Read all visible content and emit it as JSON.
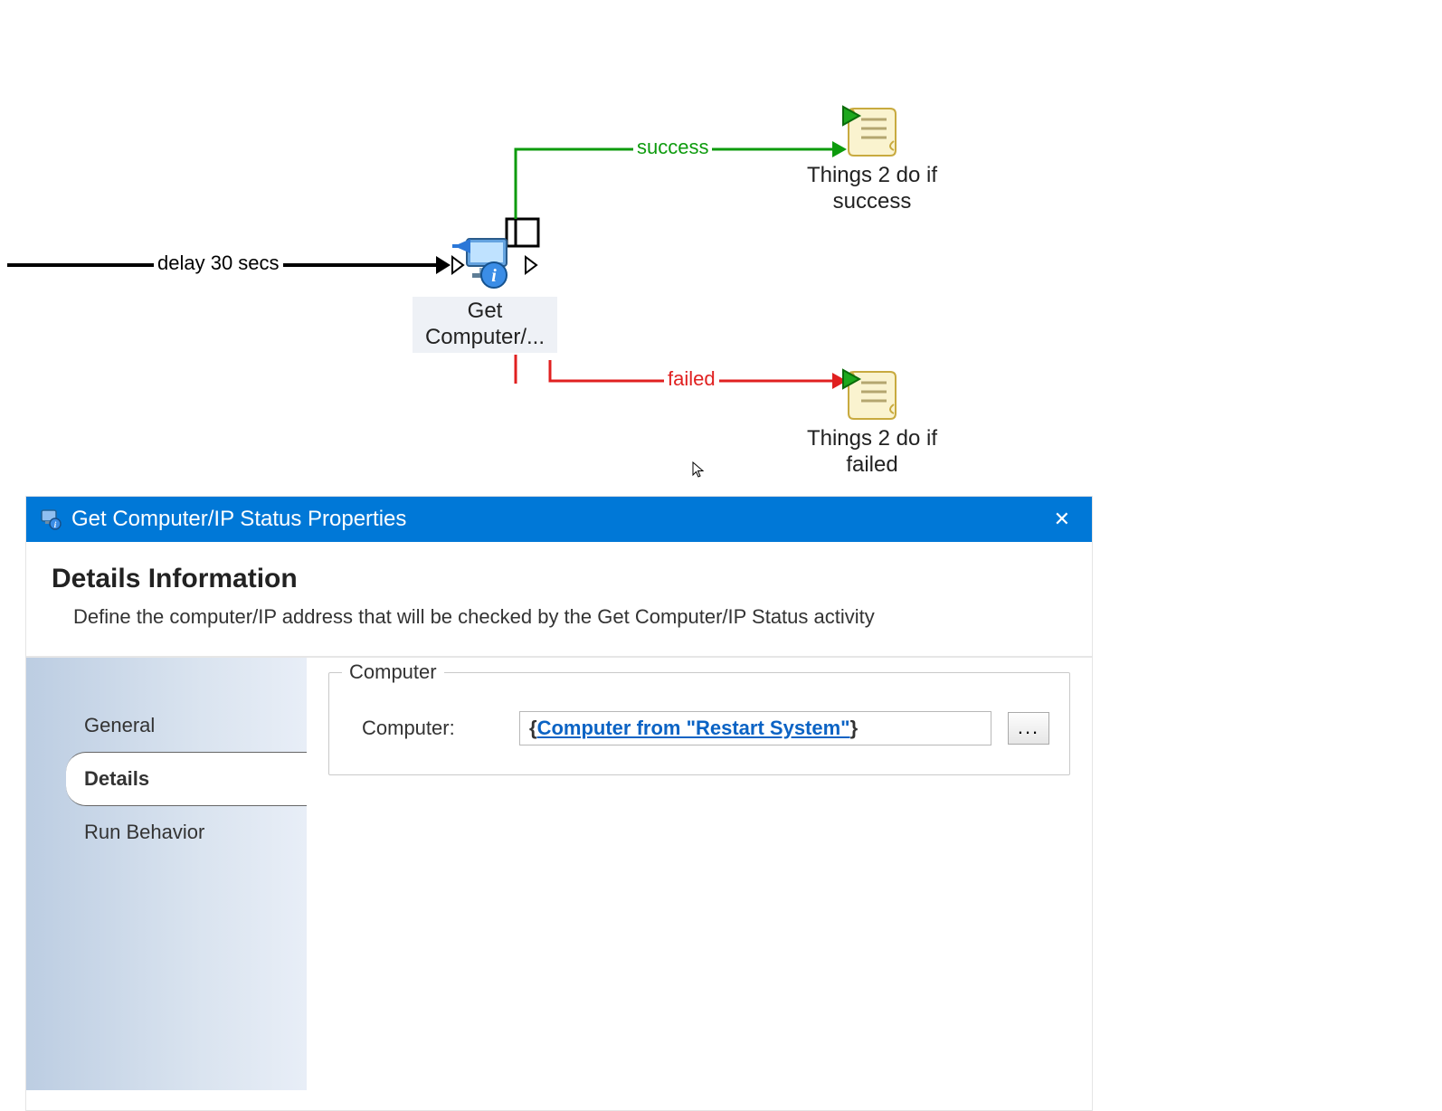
{
  "diagram": {
    "edges": {
      "delay": {
        "label": "delay 30 secs",
        "color": "#000000"
      },
      "success": {
        "label": "success",
        "color": "#0d9b0d"
      },
      "failed": {
        "label": "failed",
        "color": "#e02020"
      }
    },
    "nodes": {
      "get_computer": {
        "label": "Get Computer/...",
        "icon": "computer-info-icon"
      },
      "success_script": {
        "label": "Things 2 do if success",
        "icon": "script-play-icon"
      },
      "failed_script": {
        "label": "Things 2 do if failed",
        "icon": "script-play-icon"
      }
    }
  },
  "dialog": {
    "title": "Get Computer/IP Status Properties",
    "header": {
      "heading": "Details Information",
      "description": "Define the computer/IP address that will be checked by the Get Computer/IP Status activity"
    },
    "sidebar": {
      "items": [
        {
          "label": "General",
          "active": false
        },
        {
          "label": "Details",
          "active": true
        },
        {
          "label": "Run Behavior",
          "active": false
        }
      ]
    },
    "form": {
      "group_label": "Computer",
      "computer_label": "Computer:",
      "computer_value_prefix": "{",
      "computer_value_link": "Computer from \"Restart System\"",
      "computer_value_suffix": "}",
      "browse_label": "..."
    }
  }
}
